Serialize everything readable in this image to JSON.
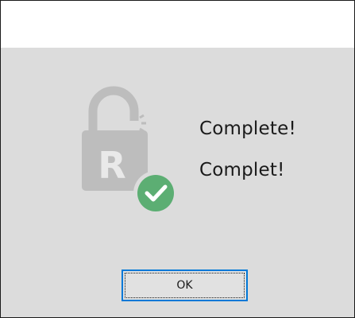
{
  "dialog": {
    "title": "",
    "icon": "lock-r-check-icon",
    "message_en": "Complete!",
    "message_fr": "Complet!",
    "ok_label": "OK"
  },
  "colors": {
    "dialog_bg": "#dcdcdc",
    "lock_grey": "#bdbdbd",
    "check_green": "#5cae73",
    "button_border": "#0078d7"
  }
}
